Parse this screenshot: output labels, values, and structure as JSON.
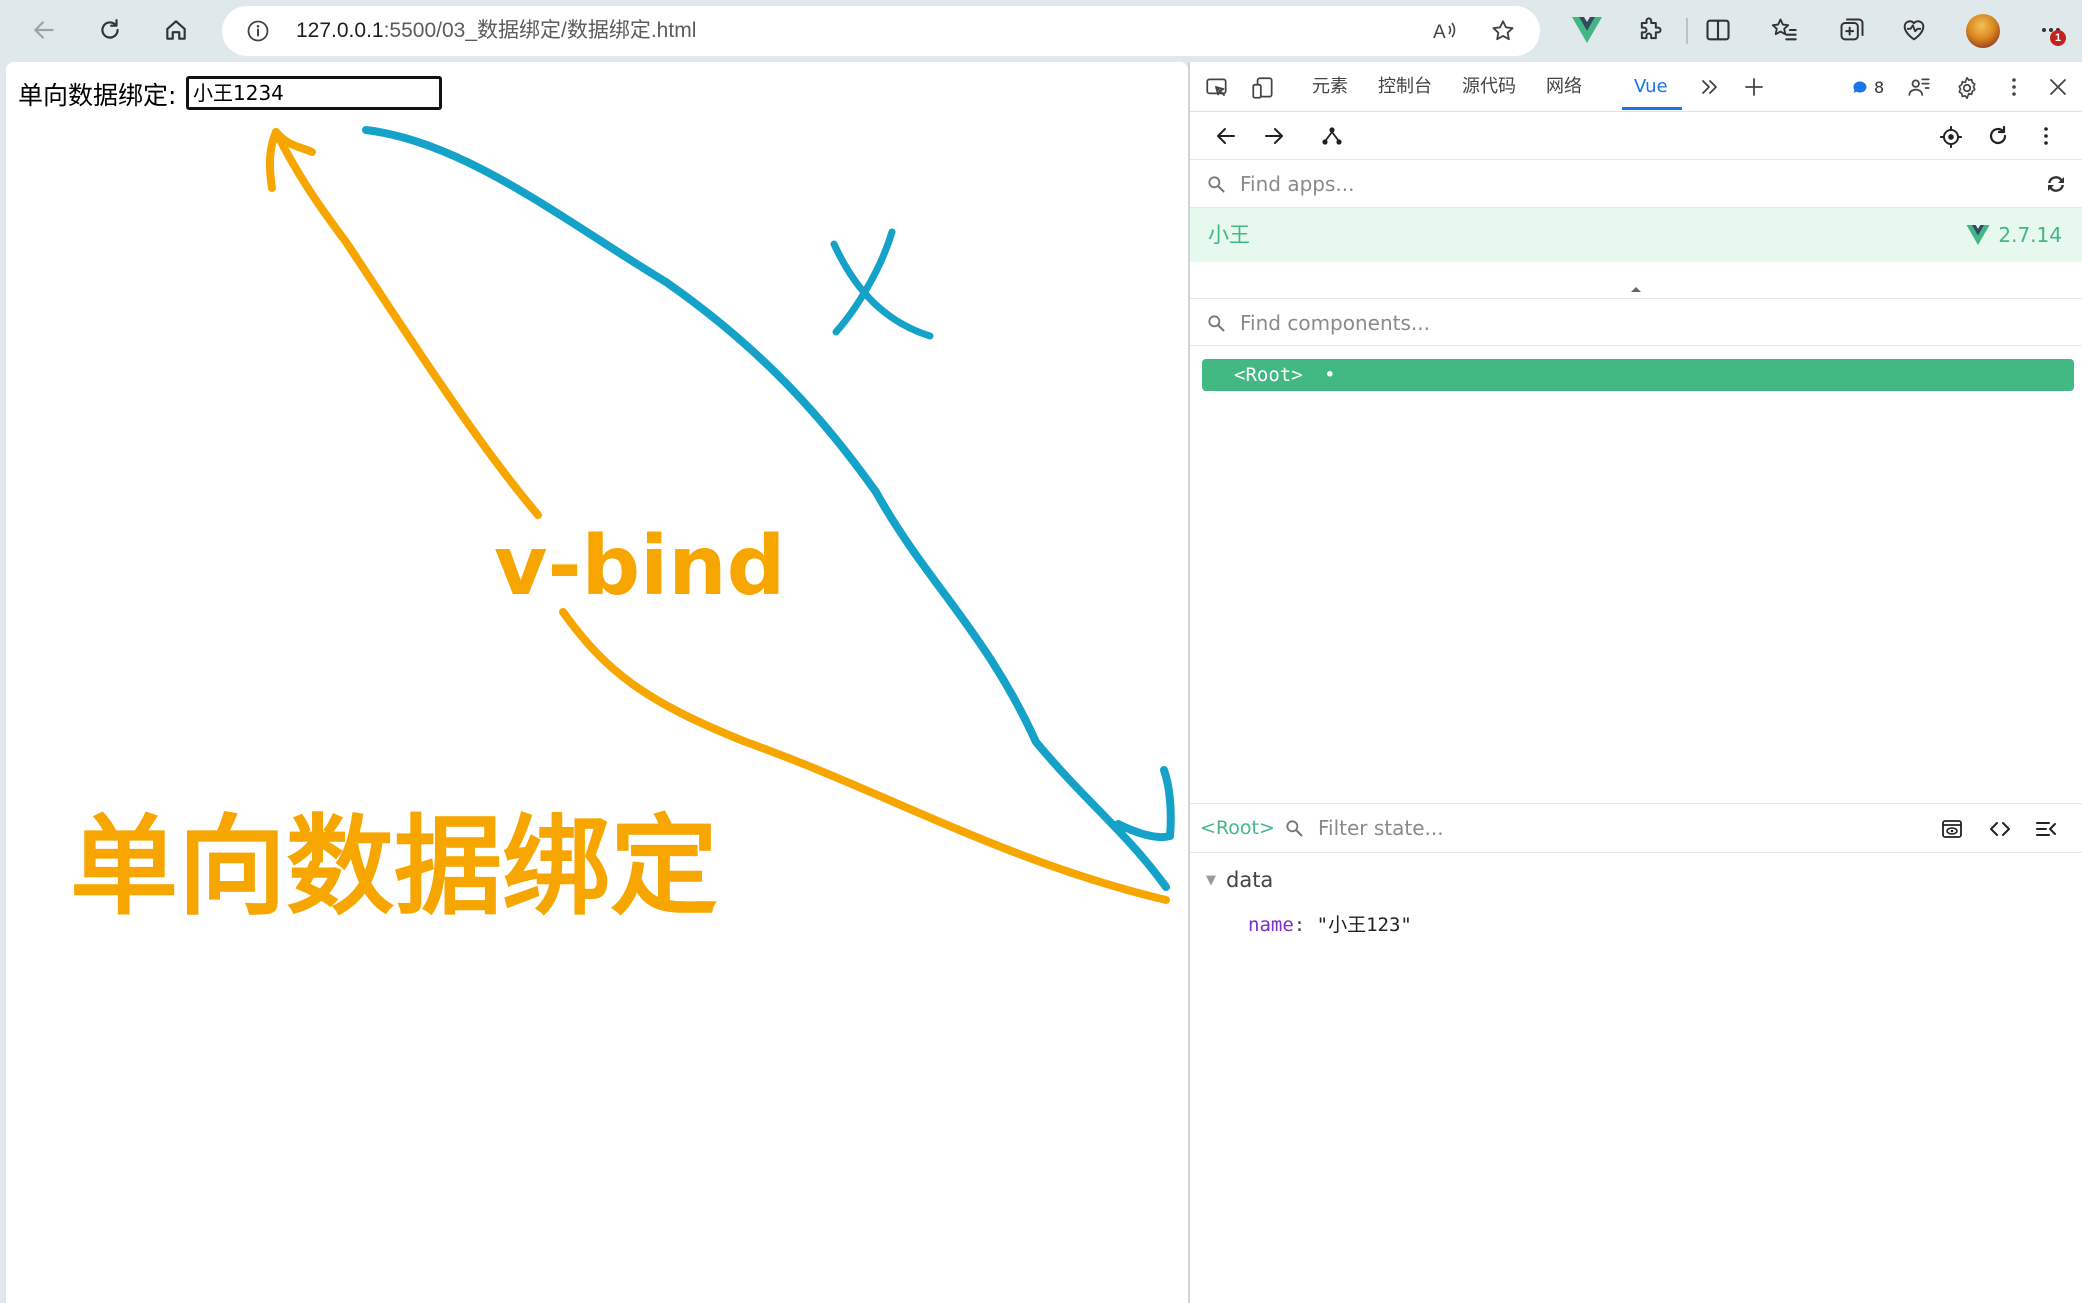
{
  "browser": {
    "url_host": "127.0.0.1",
    "url_path": ":5500/03_数据绑定/数据绑定.html",
    "notification_count": "1"
  },
  "page": {
    "label": "单向数据绑定:",
    "input_value": "小王1234",
    "annotations": {
      "directive": "v-bind",
      "caption": "单向数据绑定",
      "cross": "X",
      "colors": {
        "orange": "#f7a600",
        "blue": "#14a2c9"
      }
    }
  },
  "devtools": {
    "tabs": [
      "元素",
      "控制台",
      "源代码",
      "网络",
      "Vue"
    ],
    "active_tab": "Vue",
    "issues_count": "8",
    "vue": {
      "find_apps_placeholder": "Find apps...",
      "app_name": "小王",
      "app_version": "2.7.14",
      "find_components_placeholder": "Find components...",
      "root_component": "<Root>",
      "root_dot": "•",
      "selected_component": "<Root>",
      "filter_state_placeholder": "Filter state...",
      "state_section": "data",
      "state_key": "name",
      "state_value": "\"小王123\""
    },
    "colors": {
      "vue_green": "#42b883",
      "accent_blue": "#1a73e8"
    }
  }
}
